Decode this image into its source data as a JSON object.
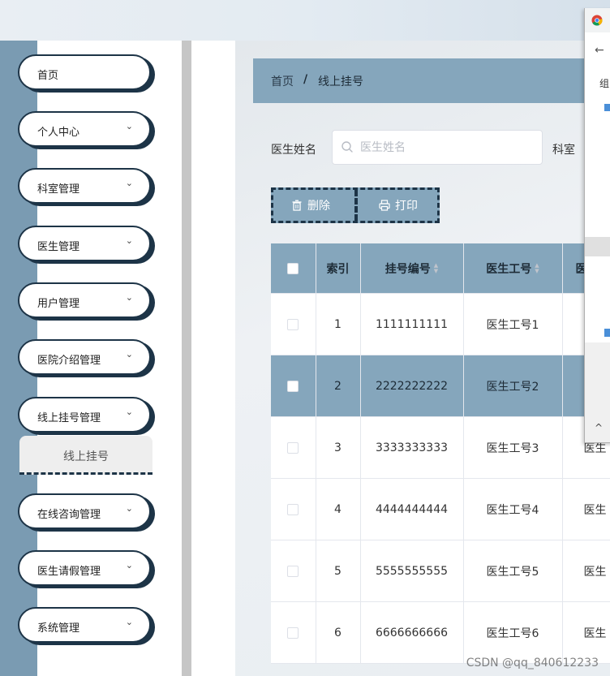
{
  "sidebar": {
    "items": [
      {
        "label": "首页",
        "has_children": false
      },
      {
        "label": "个人中心",
        "has_children": true
      },
      {
        "label": "科室管理",
        "has_children": true
      },
      {
        "label": "医生管理",
        "has_children": true
      },
      {
        "label": "用户管理",
        "has_children": true
      },
      {
        "label": "医院介绍管理",
        "has_children": true
      },
      {
        "label": "线上挂号管理",
        "has_children": true
      },
      {
        "label": "在线咨询管理",
        "has_children": true
      },
      {
        "label": "医生请假管理",
        "has_children": true
      },
      {
        "label": "系统管理",
        "has_children": true
      }
    ],
    "submenu_active": "线上挂号"
  },
  "breadcrumb": {
    "home": "首页",
    "separator": "/",
    "current": "线上挂号"
  },
  "search": {
    "label": "医生姓名",
    "placeholder": "医生姓名",
    "value": "",
    "second_label": "科室"
  },
  "toolbar": {
    "delete_label": "删除",
    "print_label": "打印"
  },
  "table": {
    "columns": [
      "索引",
      "挂号编号",
      "医生工号",
      "医"
    ],
    "sortable": [
      false,
      true,
      true,
      false
    ],
    "rows": [
      {
        "index": "1",
        "reg_no": "1111111111",
        "doctor_id": "医生工号1",
        "extra": ""
      },
      {
        "index": "2",
        "reg_no": "2222222222",
        "doctor_id": "医生工号2",
        "extra": ""
      },
      {
        "index": "3",
        "reg_no": "3333333333",
        "doctor_id": "医生工号3",
        "extra": "医生"
      },
      {
        "index": "4",
        "reg_no": "4444444444",
        "doctor_id": "医生工号4",
        "extra": "医生"
      },
      {
        "index": "5",
        "reg_no": "5555555555",
        "doctor_id": "医生工号5",
        "extra": "医生"
      },
      {
        "index": "6",
        "reg_no": "6666666666",
        "doctor_id": "医生工号6",
        "extra": "医生"
      }
    ],
    "highlighted_row": 2
  },
  "popup": {
    "title_fragment": "",
    "snippet": "组"
  },
  "watermark": "CSDN @qq_840612233",
  "colors": {
    "accent": "#85a6bc",
    "dark": "#1d3447",
    "sidebar": "#7a9bb2"
  }
}
